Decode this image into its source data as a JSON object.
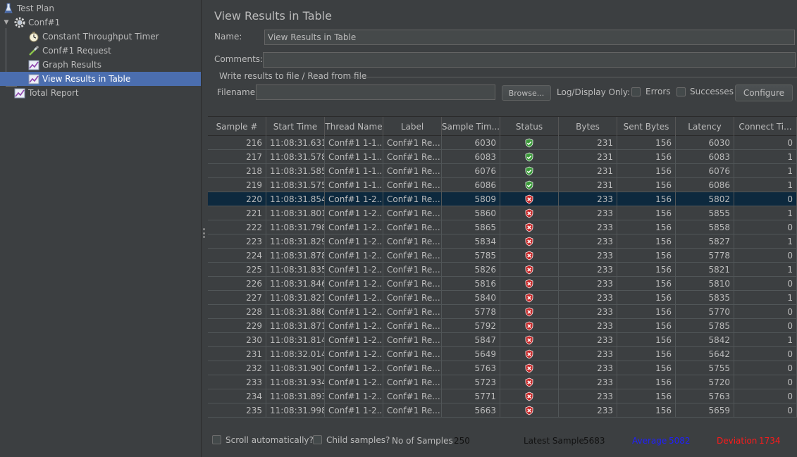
{
  "tree": {
    "items": [
      {
        "label": "Test Plan",
        "icon": "flask-icon"
      },
      {
        "label": "Conf#1",
        "icon": "gear-icon"
      },
      {
        "label": "Constant Throughput Timer",
        "icon": "timer-icon"
      },
      {
        "label": "Conf#1 Request",
        "icon": "pipette-icon"
      },
      {
        "label": "Graph Results",
        "icon": "graph-icon"
      },
      {
        "label": "View Results in Table",
        "icon": "graph-icon"
      },
      {
        "label": "Total Report",
        "icon": "graph-icon"
      }
    ]
  },
  "panel": {
    "title": "View Results in Table",
    "name_label": "Name:",
    "name_value": "View Results in Table",
    "comments_label": "Comments:",
    "comments_value": "",
    "fieldset_title": "Write results to file / Read from file",
    "filename_label": "Filename",
    "filename_value": "",
    "browse_label": "Browse...",
    "log_display_label": "Log/Display Only:",
    "errors_label": "Errors",
    "successes_label": "Successes",
    "configure_label": "Configure"
  },
  "table": {
    "headers": [
      "Sample #",
      "Start Time",
      "Thread Name",
      "Label",
      "Sample Tim...",
      "Status",
      "Bytes",
      "Sent Bytes",
      "Latency",
      "Connect Ti..."
    ],
    "rows": [
      {
        "sample": "216",
        "start": "11:08:31.631",
        "thread": "Conf#1 1-1...",
        "label": "Conf#1 Re...",
        "time": "6030",
        "status": "success",
        "bytes": "231",
        "sent": "156",
        "latency": "6030",
        "connect": "0"
      },
      {
        "sample": "217",
        "start": "11:08:31.578",
        "thread": "Conf#1 1-1...",
        "label": "Conf#1 Re...",
        "time": "6083",
        "status": "success",
        "bytes": "231",
        "sent": "156",
        "latency": "6083",
        "connect": "1"
      },
      {
        "sample": "218",
        "start": "11:08:31.585",
        "thread": "Conf#1 1-1...",
        "label": "Conf#1 Re...",
        "time": "6076",
        "status": "success",
        "bytes": "231",
        "sent": "156",
        "latency": "6076",
        "connect": "1"
      },
      {
        "sample": "219",
        "start": "11:08:31.575",
        "thread": "Conf#1 1-1...",
        "label": "Conf#1 Re...",
        "time": "6086",
        "status": "success",
        "bytes": "231",
        "sent": "156",
        "latency": "6086",
        "connect": "1"
      },
      {
        "sample": "220",
        "start": "11:08:31.854",
        "thread": "Conf#1 1-2...",
        "label": "Conf#1 Re...",
        "time": "5809",
        "status": "error",
        "bytes": "233",
        "sent": "156",
        "latency": "5802",
        "connect": "0",
        "selected": true
      },
      {
        "sample": "221",
        "start": "11:08:31.801",
        "thread": "Conf#1 1-2...",
        "label": "Conf#1 Re...",
        "time": "5860",
        "status": "error",
        "bytes": "233",
        "sent": "156",
        "latency": "5855",
        "connect": "1"
      },
      {
        "sample": "222",
        "start": "11:08:31.798",
        "thread": "Conf#1 1-2...",
        "label": "Conf#1 Re...",
        "time": "5865",
        "status": "error",
        "bytes": "233",
        "sent": "156",
        "latency": "5858",
        "connect": "0"
      },
      {
        "sample": "223",
        "start": "11:08:31.829",
        "thread": "Conf#1 1-2...",
        "label": "Conf#1 Re...",
        "time": "5834",
        "status": "error",
        "bytes": "233",
        "sent": "156",
        "latency": "5827",
        "connect": "1"
      },
      {
        "sample": "224",
        "start": "11:08:31.878",
        "thread": "Conf#1 1-2...",
        "label": "Conf#1 Re...",
        "time": "5785",
        "status": "error",
        "bytes": "233",
        "sent": "156",
        "latency": "5778",
        "connect": "0"
      },
      {
        "sample": "225",
        "start": "11:08:31.835",
        "thread": "Conf#1 1-2...",
        "label": "Conf#1 Re...",
        "time": "5826",
        "status": "error",
        "bytes": "233",
        "sent": "156",
        "latency": "5821",
        "connect": "1"
      },
      {
        "sample": "226",
        "start": "11:08:31.846",
        "thread": "Conf#1 1-2...",
        "label": "Conf#1 Re...",
        "time": "5816",
        "status": "error",
        "bytes": "233",
        "sent": "156",
        "latency": "5810",
        "connect": "0"
      },
      {
        "sample": "227",
        "start": "11:08:31.821",
        "thread": "Conf#1 1-2...",
        "label": "Conf#1 Re...",
        "time": "5840",
        "status": "error",
        "bytes": "233",
        "sent": "156",
        "latency": "5835",
        "connect": "1"
      },
      {
        "sample": "228",
        "start": "11:08:31.886",
        "thread": "Conf#1 1-2...",
        "label": "Conf#1 Re...",
        "time": "5778",
        "status": "error",
        "bytes": "233",
        "sent": "156",
        "latency": "5770",
        "connect": "0"
      },
      {
        "sample": "229",
        "start": "11:08:31.871",
        "thread": "Conf#1 1-2...",
        "label": "Conf#1 Re...",
        "time": "5792",
        "status": "error",
        "bytes": "233",
        "sent": "156",
        "latency": "5785",
        "connect": "0"
      },
      {
        "sample": "230",
        "start": "11:08:31.814",
        "thread": "Conf#1 1-2...",
        "label": "Conf#1 Re...",
        "time": "5847",
        "status": "error",
        "bytes": "233",
        "sent": "156",
        "latency": "5842",
        "connect": "1"
      },
      {
        "sample": "231",
        "start": "11:08:32.014",
        "thread": "Conf#1 1-2...",
        "label": "Conf#1 Re...",
        "time": "5649",
        "status": "error",
        "bytes": "233",
        "sent": "156",
        "latency": "5642",
        "connect": "0"
      },
      {
        "sample": "232",
        "start": "11:08:31.901",
        "thread": "Conf#1 1-2...",
        "label": "Conf#1 Re...",
        "time": "5763",
        "status": "error",
        "bytes": "233",
        "sent": "156",
        "latency": "5755",
        "connect": "0"
      },
      {
        "sample": "233",
        "start": "11:08:31.934",
        "thread": "Conf#1 1-2...",
        "label": "Conf#1 Re...",
        "time": "5723",
        "status": "error",
        "bytes": "233",
        "sent": "156",
        "latency": "5720",
        "connect": "0"
      },
      {
        "sample": "234",
        "start": "11:08:31.893",
        "thread": "Conf#1 1-2...",
        "label": "Conf#1 Re...",
        "time": "5771",
        "status": "error",
        "bytes": "233",
        "sent": "156",
        "latency": "5763",
        "connect": "0"
      },
      {
        "sample": "235",
        "start": "11:08:31.998",
        "thread": "Conf#1 1-2...",
        "label": "Conf#1 Re...",
        "time": "5663",
        "status": "error",
        "bytes": "233",
        "sent": "156",
        "latency": "5659",
        "connect": "0"
      }
    ]
  },
  "footer": {
    "scroll_label": "Scroll automatically?",
    "child_label": "Child samples?",
    "samples_label": "No of Samples",
    "samples_value": "250",
    "latest_label": "Latest Sample",
    "latest_value": "5683",
    "average_label": "Average",
    "average_value": "5082",
    "deviation_label": "Deviation",
    "deviation_value": "1734"
  },
  "colors": {
    "success": "#3c9a3a",
    "error": "#c62828",
    "average": "#1f1fff",
    "deviation": "#ff1a1a",
    "selection": "#4b6eaf"
  }
}
